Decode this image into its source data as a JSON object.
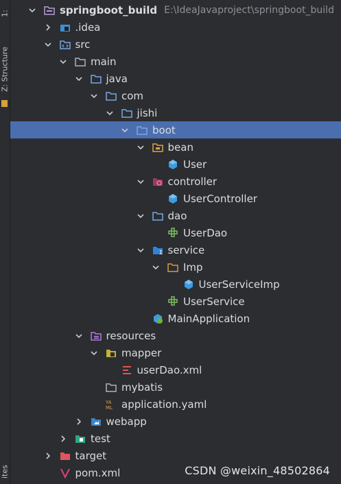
{
  "side_panel": {
    "project_tab": "1: ",
    "structure_tab": "Z: Structure",
    "favorites_tab": "ites"
  },
  "tree": {
    "root": {
      "name": "springboot_build",
      "path": "E:\\IdeaJavaproject\\springboot_build"
    },
    "items": [
      {
        "label": "springboot_build",
        "level": 0,
        "expanded": true,
        "icon": "module-folder-icon",
        "name": "tree-root"
      },
      {
        "label": ".idea",
        "level": 1,
        "expanded": false,
        "icon": "idea-folder-icon",
        "name": "tree-idea"
      },
      {
        "label": "src",
        "level": 1,
        "expanded": true,
        "icon": "source-folder-icon",
        "name": "tree-src"
      },
      {
        "label": "main",
        "level": 2,
        "expanded": true,
        "icon": "folder-icon",
        "name": "tree-main"
      },
      {
        "label": "java",
        "level": 3,
        "expanded": true,
        "icon": "blue-folder-icon",
        "name": "tree-java"
      },
      {
        "label": "com",
        "level": 4,
        "expanded": true,
        "icon": "package-icon",
        "name": "tree-com"
      },
      {
        "label": "jishi",
        "level": 5,
        "expanded": true,
        "icon": "package-icon",
        "name": "tree-jishi"
      },
      {
        "label": "boot",
        "level": 6,
        "expanded": true,
        "icon": "package-icon",
        "name": "tree-boot",
        "selected": true
      },
      {
        "label": "bean",
        "level": 7,
        "expanded": true,
        "icon": "bean-folder-icon",
        "name": "tree-bean"
      },
      {
        "label": "User",
        "level": 8,
        "icon": "class-icon",
        "name": "tree-user"
      },
      {
        "label": "controller",
        "level": 7,
        "expanded": true,
        "icon": "controller-folder-icon",
        "name": "tree-controller"
      },
      {
        "label": "UserController",
        "level": 8,
        "icon": "class-icon",
        "name": "tree-usercontroller"
      },
      {
        "label": "dao",
        "level": 7,
        "expanded": true,
        "icon": "package-icon",
        "name": "tree-dao"
      },
      {
        "label": "UserDao",
        "level": 8,
        "icon": "interface-icon",
        "name": "tree-userdao"
      },
      {
        "label": "service",
        "level": 7,
        "expanded": true,
        "icon": "service-folder-icon",
        "name": "tree-service"
      },
      {
        "label": "Imp",
        "level": 8,
        "expanded": true,
        "icon": "orange-folder-icon",
        "name": "tree-imp"
      },
      {
        "label": "UserServiceImp",
        "level": 9,
        "icon": "class-icon",
        "name": "tree-userserviceimp"
      },
      {
        "label": "UserService",
        "level": 8,
        "icon": "interface-icon",
        "name": "tree-userservice"
      },
      {
        "label": "MainApplication",
        "level": 7,
        "icon": "spring-class-icon",
        "name": "tree-mainapplication"
      },
      {
        "label": "resources",
        "level": 3,
        "expanded": true,
        "icon": "resources-folder-icon",
        "name": "tree-resources"
      },
      {
        "label": "mapper",
        "level": 4,
        "expanded": true,
        "icon": "mapper-folder-icon",
        "name": "tree-mapper"
      },
      {
        "label": "userDao.xml",
        "level": 5,
        "icon": "xml-file-icon",
        "name": "tree-userdao-xml"
      },
      {
        "label": "mybatis",
        "level": 4,
        "icon": "folder-icon",
        "name": "tree-mybatis"
      },
      {
        "label": "application.yaml",
        "level": 4,
        "icon": "yaml-file-icon",
        "name": "tree-application-yaml"
      },
      {
        "label": "webapp",
        "level": 3,
        "expanded": false,
        "icon": "web-folder-icon",
        "name": "tree-webapp"
      },
      {
        "label": "test",
        "level": 2,
        "expanded": false,
        "icon": "test-folder-icon",
        "name": "tree-test"
      },
      {
        "label": "target",
        "level": 1,
        "expanded": false,
        "icon": "excluded-folder-icon",
        "name": "tree-target"
      },
      {
        "label": "pom.xml",
        "level": 1,
        "icon": "maven-file-icon",
        "name": "tree-pom"
      }
    ]
  },
  "watermark": "CSDN @weixin_48502864",
  "colors": {
    "background": "#2b2d30",
    "selection": "#4b6eaf",
    "text": "#d9dce1",
    "path": "#8c9098"
  }
}
